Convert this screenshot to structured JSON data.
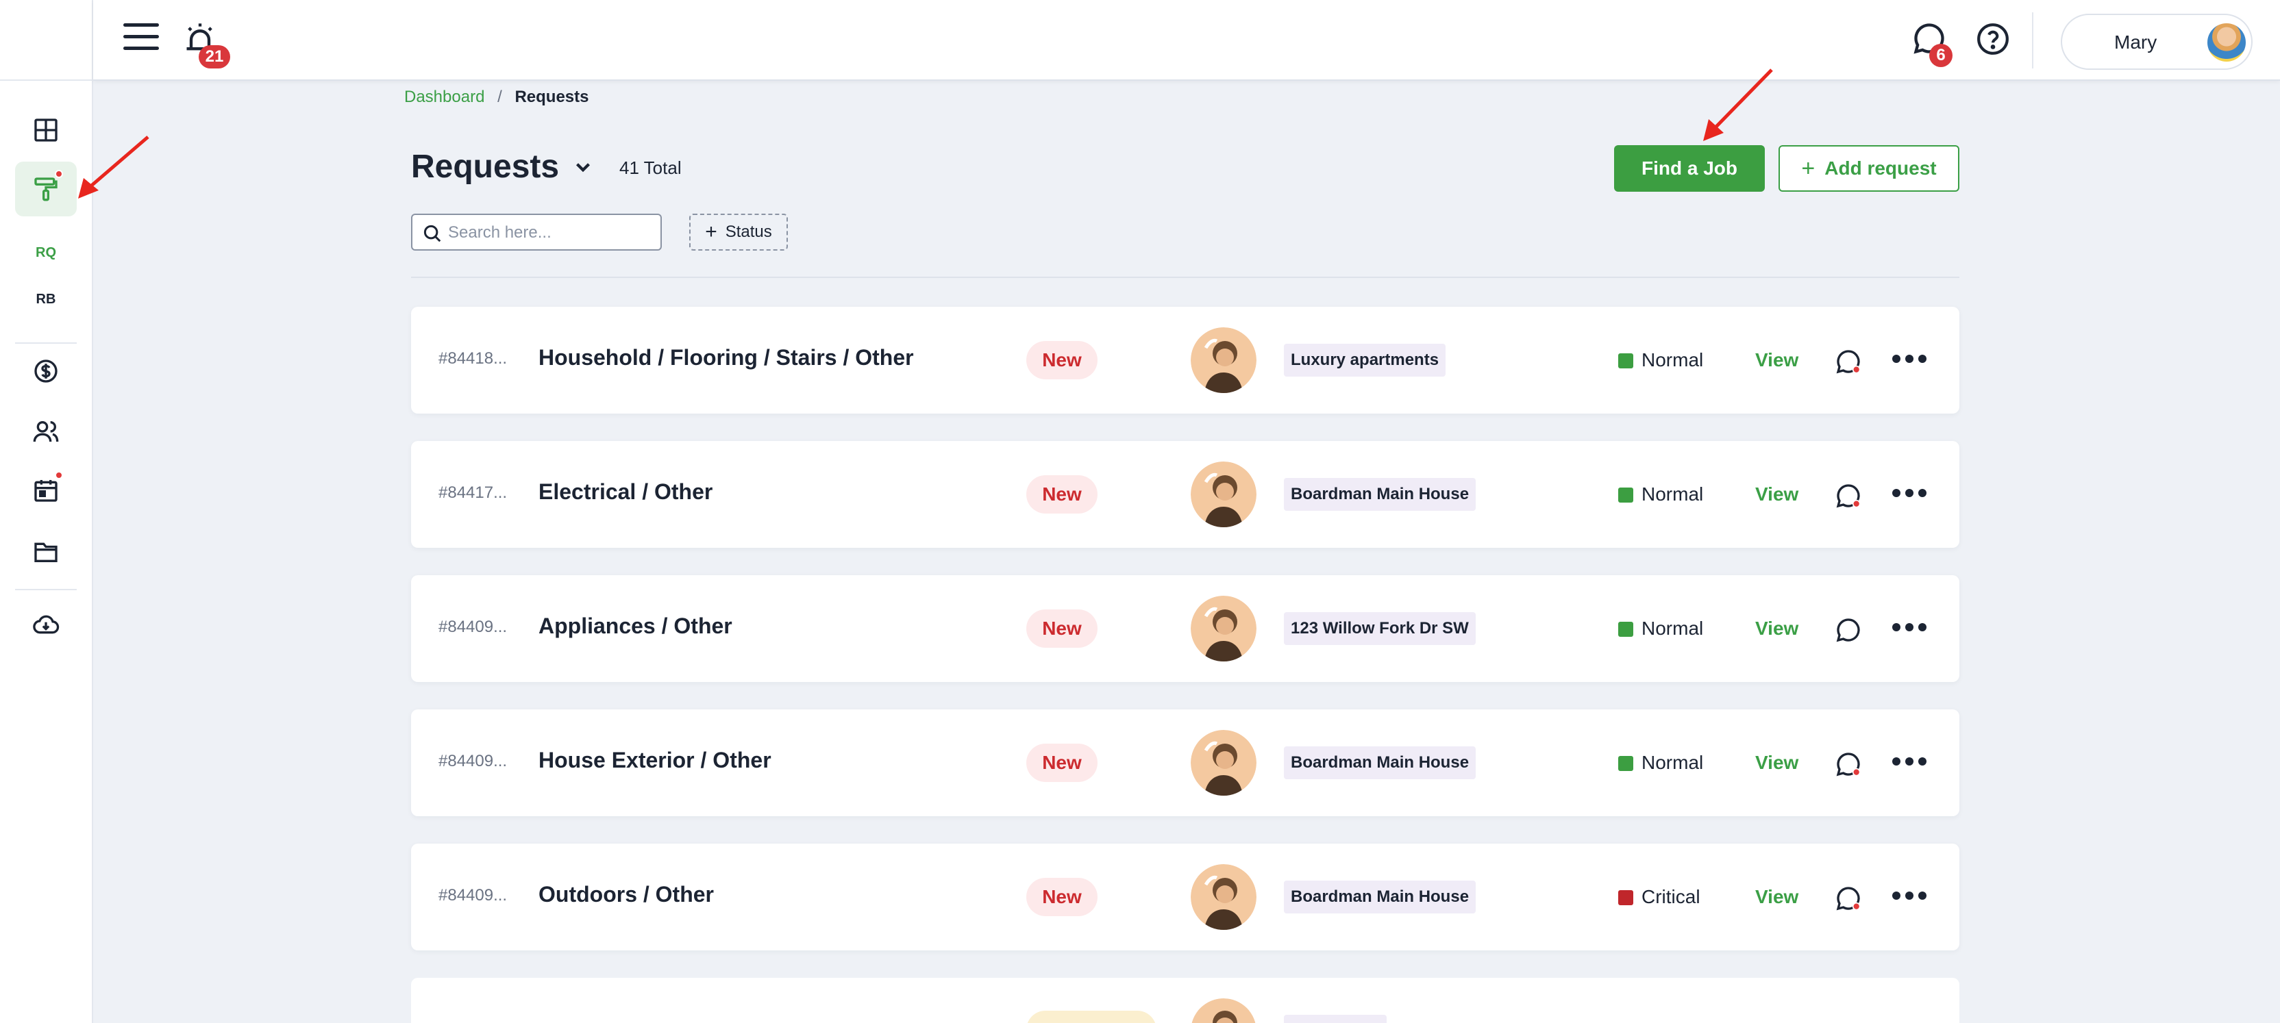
{
  "header": {
    "alerts_count": "21",
    "messages_count": "6",
    "user_name": "Mary"
  },
  "sidebar": {
    "items": [
      {
        "name": "dashboard",
        "icon": "layout-icon"
      },
      {
        "name": "requests",
        "icon": "paint-roller-icon",
        "active": true
      },
      {
        "name": "financials",
        "icon": "dollar-circle-icon"
      },
      {
        "name": "contacts",
        "icon": "users-icon"
      },
      {
        "name": "calendar",
        "icon": "calendar-icon"
      },
      {
        "name": "files",
        "icon": "folder-icon"
      },
      {
        "name": "downloads",
        "icon": "cloud-download-icon"
      }
    ],
    "sub_rq": "RQ",
    "sub_rb": "RB"
  },
  "breadcrumb": {
    "home": "Dashboard",
    "separator": "/",
    "current": "Requests"
  },
  "page": {
    "title": "Requests",
    "total": "41 Total",
    "find_job_label": "Find a Job",
    "add_request_label": "Add request",
    "search_placeholder": "Search here...",
    "status_filter_label": "Status"
  },
  "requests": [
    {
      "id": "#84418...",
      "title": "Household / Flooring / Stairs / Other",
      "status": "New",
      "property": "Luxury apartments",
      "priority": "Normal",
      "priority_color": "#3c9e41",
      "view": "View",
      "unread": true
    },
    {
      "id": "#84417...",
      "title": "Electrical / Other",
      "status": "New",
      "property": "Boardman Main House",
      "priority": "Normal",
      "priority_color": "#3c9e41",
      "view": "View",
      "unread": true
    },
    {
      "id": "#84409...",
      "title": "Appliances / Other",
      "status": "New",
      "property": "123 Willow Fork Dr SW",
      "priority": "Normal",
      "priority_color": "#3c9e41",
      "view": "View",
      "unread": false
    },
    {
      "id": "#84409...",
      "title": "House Exterior / Other",
      "status": "New",
      "property": "Boardman Main House",
      "priority": "Normal",
      "priority_color": "#3c9e41",
      "view": "View",
      "unread": true
    },
    {
      "id": "#84409...",
      "title": "Outdoors / Other",
      "status": "New",
      "property": "Boardman Main House",
      "priority": "Critical",
      "priority_color": "#c0262b",
      "view": "View",
      "unread": true
    }
  ],
  "colors": {
    "accent": "#3c9e41",
    "badge": "#d9373b",
    "background": "#eef1f6"
  }
}
